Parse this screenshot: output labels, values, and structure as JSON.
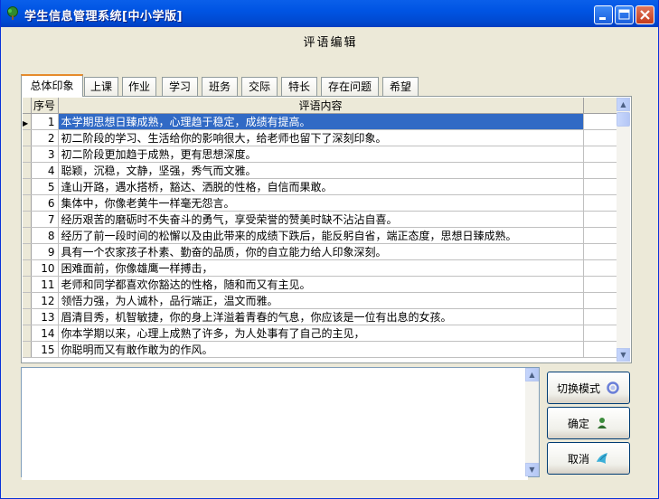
{
  "window": {
    "title": "学生信息管理系统[中小学版]"
  },
  "heading": "评语编辑",
  "tabs": [
    "总体印象",
    "上课",
    "作业",
    "学习",
    "班务",
    "交际",
    "特长",
    "存在问题",
    "希望"
  ],
  "active_tab": "总体印象",
  "grid": {
    "columns": [
      "序号",
      "评语内容"
    ],
    "rows": [
      {
        "no": "1",
        "text": "本学期思想日臻成熟，心理趋于稳定，成绩有提高。"
      },
      {
        "no": "2",
        "text": "初二阶段的学习、生活给你的影响很大，给老师也留下了深刻印象。"
      },
      {
        "no": "3",
        "text": "初二阶段更加趋于成熟，更有思想深度。"
      },
      {
        "no": "4",
        "text": "聪颖，沉稳，文静，坚强，秀气而文雅。"
      },
      {
        "no": "5",
        "text": "逢山开路，遇水搭桥，豁达、洒脱的性格，自信而果敢。"
      },
      {
        "no": "6",
        "text": "集体中，你像老黄牛一样毫无怨言。"
      },
      {
        "no": "7",
        "text": "经历艰苦的磨砺时不失奋斗的勇气，享受荣誉的赞美时缺不沾沾自喜。"
      },
      {
        "no": "8",
        "text": "经历了前一段时间的松懈以及由此带来的成绩下跌后，能反躬自省，端正态度，思想日臻成熟。"
      },
      {
        "no": "9",
        "text": "具有一个农家孩子朴素、勤奋的品质，你的自立能力给人印象深刻。"
      },
      {
        "no": "10",
        "text": "困难面前，你像雄鹰一样搏击，"
      },
      {
        "no": "11",
        "text": "老师和同学都喜欢你豁达的性格，随和而又有主见。"
      },
      {
        "no": "12",
        "text": "领悟力强，为人诚朴，品行端正，温文而雅。"
      },
      {
        "no": "13",
        "text": "眉清目秀，机智敏捷，你的身上洋溢着青春的气息，你应该是一位有出息的女孩。"
      },
      {
        "no": "14",
        "text": "你本学期以来，心理上成熟了许多，为人处事有了自己的主见，"
      },
      {
        "no": "15",
        "text": "你聪明而又有敢作敢为的作风。"
      }
    ],
    "selected_row": 0
  },
  "memo": {
    "value": ""
  },
  "buttons": {
    "switch_mode": "切换模式",
    "ok": "确定",
    "cancel": "取消"
  },
  "icons": {
    "app": "tree-icon",
    "switch_mode": "refresh-icon",
    "ok": "user-icon",
    "cancel": "bird-icon"
  },
  "colors": {
    "titlebar": "#0054E3",
    "selection": "#316AC5",
    "tab_highlight": "#E68B2C",
    "window_bg": "#ECE9D8"
  }
}
